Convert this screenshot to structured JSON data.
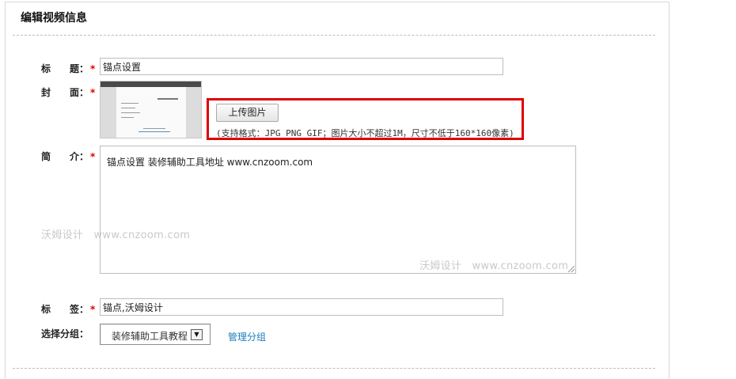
{
  "panel": {
    "title": "编辑视频信息"
  },
  "form": {
    "title": {
      "label": "标　　题：",
      "required_mark": "*",
      "value": "锚点设置"
    },
    "cover": {
      "label": "封　　面：",
      "required_mark": "*"
    },
    "upload": {
      "button_label": "上传图片",
      "hint": "(支持格式：JPG PNG GIF；图片大小不超过1M，尺寸不低于160*160像素)"
    },
    "intro": {
      "label": "简　　介：",
      "required_mark": "*",
      "value": "锚点设置 装修辅助工具地址 www.cnzoom.com"
    },
    "tags": {
      "label": "标　　签：",
      "required_mark": "*",
      "value": "锚点,沃姆设计"
    },
    "group": {
      "label": "选择分组：",
      "selected": "装修辅助工具教程",
      "arrow": "▼",
      "manage_link": "管理分组"
    }
  },
  "watermarks": [
    "沃姆设计　www.cnzoom.com",
    "沃姆设计　www.cnzoom.com"
  ],
  "colors": {
    "highlight": "#e00000",
    "link": "#1a7fb8",
    "required": "#dd0000"
  }
}
